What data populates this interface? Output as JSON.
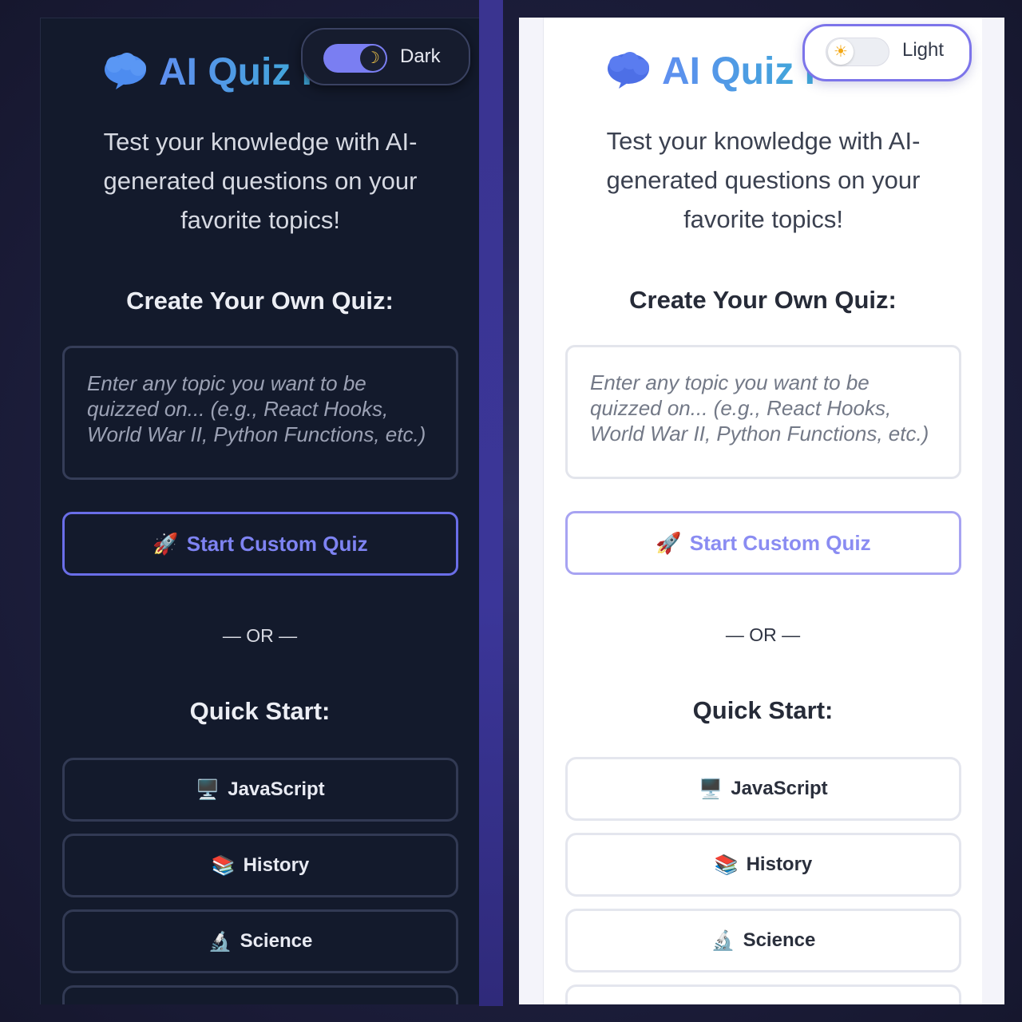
{
  "app": {
    "title": "AI Quiz I",
    "subtitle": "Test your knowledge with AI-generated questions on your favorite topics!"
  },
  "dark_panel": {
    "theme_toggle": {
      "label": "Dark",
      "knob_icon": "☽",
      "state": "on"
    },
    "create_heading": "Create Your Own Quiz:",
    "topic_placeholder": "Enter any topic you want to be quizzed on... (e.g., React Hooks, World War II, Python Functions, etc.)",
    "custom_button": {
      "icon": "🚀",
      "label": "Start Custom Quiz"
    },
    "or_text": "— OR —",
    "quick_heading": "Quick Start:",
    "quick_topics": [
      {
        "icon": "🖥️",
        "label": "JavaScript"
      },
      {
        "icon": "📚",
        "label": "History"
      },
      {
        "icon": "🔬",
        "label": "Science"
      },
      {
        "icon": "",
        "label": ""
      }
    ]
  },
  "light_panel": {
    "theme_toggle": {
      "label": "Light",
      "knob_icon": "☀",
      "state": "off"
    },
    "create_heading": "Create Your Own Quiz:",
    "topic_placeholder": "Enter any topic you want to be quizzed on... (e.g., React Hooks, World War II, Python Functions, etc.)",
    "custom_button": {
      "icon": "🚀",
      "label": "Start Custom Quiz"
    },
    "or_text": "— OR —",
    "quick_heading": "Quick Start:",
    "quick_topics": [
      {
        "icon": "🖥️",
        "label": "JavaScript"
      },
      {
        "icon": "📚",
        "label": "History"
      },
      {
        "icon": "🔬",
        "label": "Science"
      },
      {
        "icon": "",
        "label": ""
      }
    ]
  },
  "colors": {
    "accent": "#6a6ee8",
    "title_gradient_start": "#5f8ff0",
    "title_gradient_end": "#3ea8d8",
    "dark_bg": "#131a2c",
    "light_bg": "#ffffff"
  }
}
